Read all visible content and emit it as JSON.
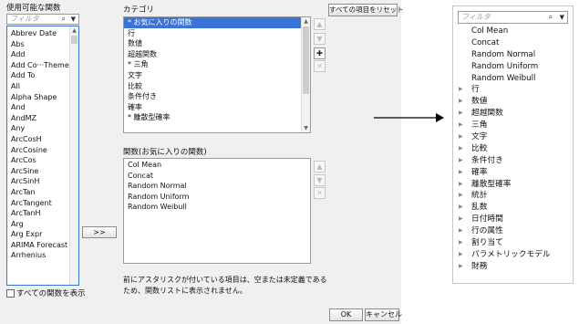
{
  "dialog": {
    "available_label": "使用可能な関数",
    "filter_placeholder": "フィルタ",
    "functions": [
      "Abbrev Date",
      "Abs",
      "Add",
      "Add Co···Theme",
      "Add To",
      "All",
      "Alpha Shape",
      "And",
      "AndMZ",
      "Any",
      "ArcCosH",
      "ArcCosine",
      "ArcCos",
      "ArcSine",
      "ArcSinH",
      "ArcTan",
      "ArcTangent",
      "ArcTanH",
      "Arg",
      "Arg Expr",
      "ARIMA Forecast",
      "Arrhenius"
    ],
    "show_all_label": "すべての関数を表示",
    "add_button": ">>",
    "category_label": "カテゴリ",
    "reset_button": "すべての項目をリセット",
    "categories": [
      "* お気に入りの関数",
      "行",
      "数値",
      "超越関数",
      "* 三角",
      "文字",
      "比較",
      "条件付き",
      "確率",
      "* 離散型確率"
    ],
    "category_selected_index": 0,
    "functions_panel_label": "関数(お気に入りの関数)",
    "favorites": [
      "Col Mean",
      "Concat",
      "Random Normal",
      "Random Uniform",
      "Random Weibull"
    ],
    "note": "前にアスタリスクが付いている項目は、空または未定義であるため、関数リストに表示されません。",
    "ok_button": "OK",
    "cancel_button": "キャンセル",
    "icon_up": "arrow-up-icon",
    "icon_down": "arrow-down-icon",
    "icon_add": "plus-icon",
    "icon_remove": "x-icon",
    "accent_color": "#3b73d6"
  },
  "panel": {
    "filter_placeholder": "フィルタ",
    "items": [
      {
        "text": "Col Mean",
        "expandable": false
      },
      {
        "text": "Concat",
        "expandable": false
      },
      {
        "text": "Random Normal",
        "expandable": false
      },
      {
        "text": "Random Uniform",
        "expandable": false
      },
      {
        "text": "Random Weibull",
        "expandable": false
      },
      {
        "text": "行",
        "expandable": true
      },
      {
        "text": "数値",
        "expandable": true
      },
      {
        "text": "超越関数",
        "expandable": true
      },
      {
        "text": "三角",
        "expandable": true
      },
      {
        "text": "文字",
        "expandable": true
      },
      {
        "text": "比較",
        "expandable": true
      },
      {
        "text": "条件付き",
        "expandable": true
      },
      {
        "text": "確率",
        "expandable": true
      },
      {
        "text": "離散型確率",
        "expandable": true
      },
      {
        "text": "統計",
        "expandable": true
      },
      {
        "text": "乱数",
        "expandable": true
      },
      {
        "text": "日付時間",
        "expandable": true
      },
      {
        "text": "行の属性",
        "expandable": true
      },
      {
        "text": "割り当て",
        "expandable": true
      },
      {
        "text": "パラメトリックモデル",
        "expandable": true
      },
      {
        "text": "財務",
        "expandable": true
      }
    ]
  }
}
